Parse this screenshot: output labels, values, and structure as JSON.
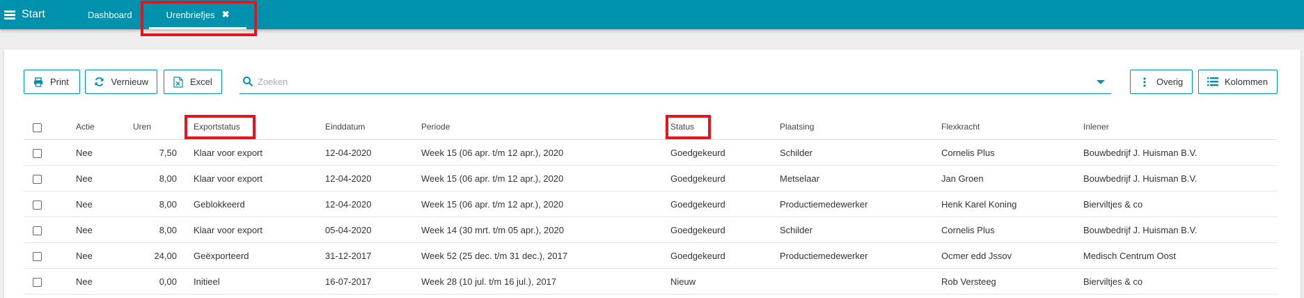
{
  "topbar": {
    "start_label": "Start",
    "tabs": [
      {
        "label": "Dashboard"
      },
      {
        "label": "Urenbriefjes",
        "close_icon": "✖"
      }
    ],
    "color": "#0091ad"
  },
  "toolbar": {
    "print_label": "Print",
    "vernieuw_label": "Vernieuw",
    "excel_label": "Excel",
    "search_placeholder": "Zoeken",
    "overig_label": "Overig",
    "kolommen_label": "Kolommen"
  },
  "table": {
    "headers": {
      "actie": "Actie",
      "uren": "Uren",
      "exportstatus": "Exportstatus",
      "einddatum": "Einddatum",
      "periode": "Periode",
      "status": "Status",
      "plaatsing": "Plaatsing",
      "flexkracht": "Flexkracht",
      "inlener": "Inlener"
    },
    "rows": [
      {
        "actie": "Nee",
        "uren": "7,50",
        "exportstatus": "Klaar voor export",
        "einddatum": "12-04-2020",
        "periode": "Week 15 (06 apr. t/m 12 apr.), 2020",
        "status": "Goedgekeurd",
        "plaatsing": "Schilder",
        "flexkracht": "Cornelis Plus",
        "inlener": "Bouwbedrijf J. Huisman B.V."
      },
      {
        "actie": "Nee",
        "uren": "8,00",
        "exportstatus": "Klaar voor export",
        "einddatum": "12-04-2020",
        "periode": "Week 15 (06 apr. t/m 12 apr.), 2020",
        "status": "Goedgekeurd",
        "plaatsing": "Metselaar",
        "flexkracht": "Jan Groen",
        "inlener": "Bouwbedrijf J. Huisman B.V."
      },
      {
        "actie": "Nee",
        "uren": "8,00",
        "exportstatus": "Geblokkeerd",
        "einddatum": "12-04-2020",
        "periode": "Week 15 (06 apr. t/m 12 apr.), 2020",
        "status": "Goedgekeurd",
        "plaatsing": "Productiemedewerker",
        "flexkracht": "Henk Karel Koning",
        "inlener": "Bierviltjes & co"
      },
      {
        "actie": "Nee",
        "uren": "8,00",
        "exportstatus": "Klaar voor export",
        "einddatum": "05-04-2020",
        "periode": "Week 14 (30 mrt. t/m 05 apr.), 2020",
        "status": "Goedgekeurd",
        "plaatsing": "Schilder",
        "flexkracht": "Cornelis Plus",
        "inlener": "Bouwbedrijf J. Huisman B.V."
      },
      {
        "actie": "Nee",
        "uren": "24,00",
        "exportstatus": "Geëxporteerd",
        "einddatum": "31-12-2017",
        "periode": "Week 52 (25 dec. t/m 31 dec.), 2017",
        "status": "Goedgekeurd",
        "plaatsing": "Productiemedewerker",
        "flexkracht": "Ocmer edd Jssov",
        "inlener": "Medisch Centrum Oost"
      },
      {
        "actie": "Nee",
        "uren": "0,00",
        "exportstatus": "Initieel",
        "einddatum": "16-07-2017",
        "periode": "Week 28 (10 jul. t/m 16 jul.), 2017",
        "status": "Nieuw",
        "plaatsing": "",
        "flexkracht": "Rob Versteeg",
        "inlener": "Bierviltjes & co"
      }
    ]
  },
  "icons": [
    "menu-icon",
    "close-icon",
    "print-icon",
    "refresh-icon",
    "excel-icon",
    "search-icon",
    "caret-down-icon",
    "more-vertical-icon",
    "columns-list-icon"
  ],
  "highlight_color": "#e3161f"
}
